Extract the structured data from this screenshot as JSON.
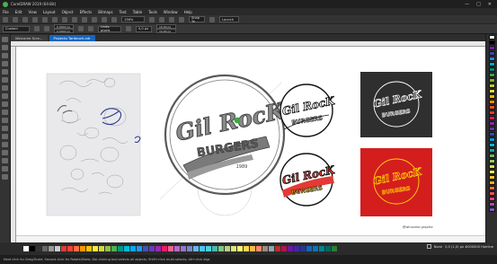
{
  "window": {
    "title": "CorelDRAW 2019 (64-Bit)",
    "controls": [
      "—",
      "□",
      "✕"
    ]
  },
  "menu": [
    "File",
    "Edit",
    "View",
    "Layout",
    "Object",
    "Effects",
    "Bitmaps",
    "Text",
    "Table",
    "Tools",
    "Window",
    "Help"
  ],
  "toolbar": {
    "zoom": "136%",
    "snap_to": "Snap To",
    "launch": "Launch"
  },
  "propbar": {
    "page_size": "Custom",
    "width": "0,0000 px",
    "height": "0,0000 px",
    "units": "Units: pixels",
    "nudge": "0,0 px",
    "dup_x": "10,00 px",
    "dup_y": "10,00 px"
  },
  "tabs": [
    {
      "label": "Welcome Scre..."
    },
    {
      "label": "Projecto Tarltouch.cdr"
    }
  ],
  "artwork": {
    "logo_line1": "Gil RocK",
    "logo_line2": "BURGERS",
    "year": "1989",
    "watermark": "@winsome.graphic"
  },
  "palette_right": [
    "#ffffff",
    "#000000",
    "#7b1fa2",
    "#3949ab",
    "#1e88e5",
    "#00acc1",
    "#00897b",
    "#43a047",
    "#7cb342",
    "#c0ca33",
    "#fdd835",
    "#ffb300",
    "#fb8c00",
    "#f4511e",
    "#e53935",
    "#d81b60",
    "#8e24aa",
    "#5e35b1",
    "#3949ab",
    "#039be5",
    "#00bcd4",
    "#26a69a",
    "#66bb6a",
    "#9ccc65",
    "#d4e157",
    "#ffee58",
    "#ffca28",
    "#ffa726",
    "#ff7043",
    "#ef5350",
    "#ec407a",
    "#ab47bc",
    "#7e57c2"
  ],
  "palette_bottom": [
    "#ffffff",
    "#000000",
    "#333333",
    "#666666",
    "#999999",
    "#cccccc",
    "#e53935",
    "#f44336",
    "#ff7043",
    "#ff9800",
    "#ffc107",
    "#ffeb3b",
    "#cddc39",
    "#8bc34a",
    "#4caf50",
    "#009688",
    "#00bcd4",
    "#03a9f4",
    "#2196f3",
    "#3f51b5",
    "#673ab7",
    "#9c27b0",
    "#e91e63",
    "#f06292",
    "#ba68c8",
    "#9575cd",
    "#7986cb",
    "#64b5f6",
    "#4fc3f7",
    "#4dd0e1",
    "#4db6ac",
    "#81c784",
    "#aed581",
    "#dce775",
    "#fff176",
    "#ffd54f",
    "#ffb74d",
    "#ff8a65",
    "#a1887f",
    "#90a4ae",
    "#c62828",
    "#ad1457",
    "#6a1b9a",
    "#4527a0",
    "#283593",
    "#1565c0",
    "#0277bd",
    "#00838f",
    "#00695c",
    "#2e7d32"
  ],
  "fill_info": {
    "fill": "None",
    "outline": "0,5 (1,0) px  #000000  Hairline"
  },
  "status": "Next click for Drag/Scale; Second click for Rotate/Skew; Dbl-clicking tool selects all objects; Shift+click multi-selects; Alt+click digs"
}
